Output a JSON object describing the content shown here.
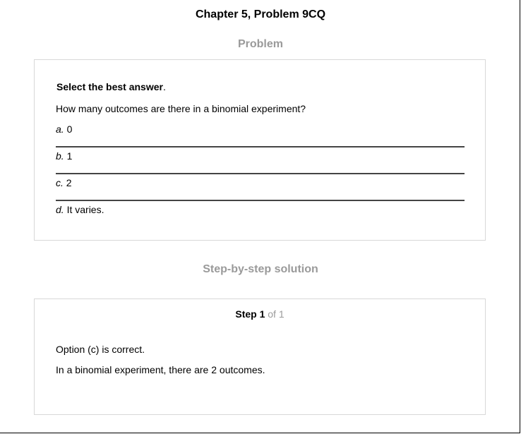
{
  "page": {
    "title": "Chapter 5, Problem 9CQ"
  },
  "problem": {
    "heading": "Problem",
    "instruction_bold": "Select the best answer",
    "instruction_tail": ".",
    "question": "How many outcomes are there in a binomial experiment?",
    "options": [
      {
        "letter": "a.",
        "text": "0"
      },
      {
        "letter": "b.",
        "text": "1"
      },
      {
        "letter": "c.",
        "text": "2"
      },
      {
        "letter": "d.",
        "text": "It varies."
      }
    ]
  },
  "solution": {
    "heading": "Step-by-step solution",
    "step_label": "Step 1",
    "step_of": "of 1",
    "lines": [
      "Option (c) is correct.",
      "In a binomial experiment, there are 2 outcomes."
    ]
  }
}
